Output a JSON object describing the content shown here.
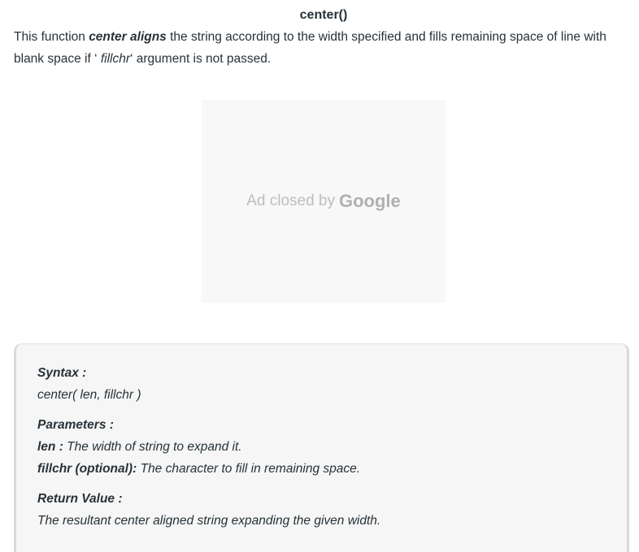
{
  "heading": "center()",
  "intro": {
    "part1": "This function ",
    "emphasis": "center aligns",
    "part2": " the string according to the width specified and fills remaining space of line with blank space if ‘ ",
    "arg": "fillchr",
    "part3": "‘ argument is not passed."
  },
  "ad": {
    "text": "Ad closed by",
    "brand": "Google"
  },
  "syntax_box": {
    "syntax_label": "Syntax :",
    "syntax_value": "center( len, fillchr )",
    "parameters_label": "Parameters :",
    "params": [
      {
        "name": "len :",
        "desc": " The width of string to expand it."
      },
      {
        "name": "fillchr (optional):",
        "desc": " The character to fill in remaining space."
      }
    ],
    "return_label": "Return Value :",
    "return_value": "The resultant center aligned string expanding the given width."
  }
}
